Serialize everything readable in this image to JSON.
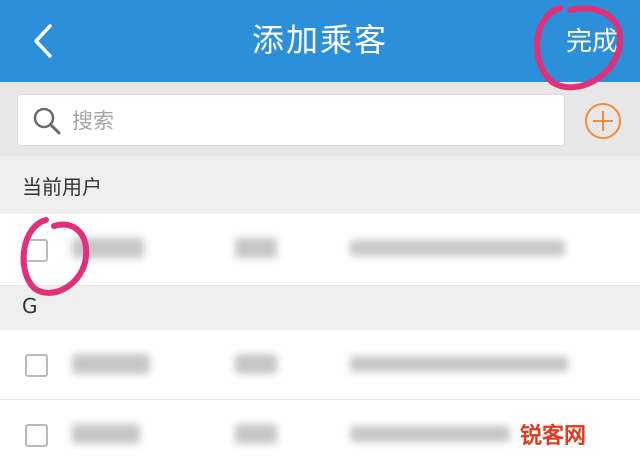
{
  "header": {
    "title": "添加乘客",
    "done_label": "完成",
    "back_icon": "chevron-left-icon",
    "bg_color": "#2b8fd9"
  },
  "search": {
    "placeholder": "搜索",
    "icon": "search-icon",
    "add_icon": "plus-circle-icon",
    "add_color": "#f08c3a"
  },
  "sections": [
    {
      "label": "当前用户",
      "rows": [
        {
          "checked": false,
          "content_obscured": true
        }
      ]
    },
    {
      "label": "G",
      "rows": [
        {
          "checked": false,
          "content_obscured": true
        },
        {
          "checked": false,
          "content_obscured": true
        }
      ]
    }
  ],
  "annotation": {
    "color": "#e0307a"
  },
  "watermark": {
    "text": "锐客网"
  }
}
